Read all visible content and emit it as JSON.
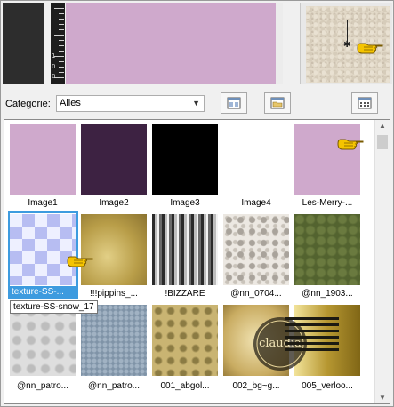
{
  "ruler": {
    "numbers": [
      "1",
      "0",
      "0"
    ]
  },
  "category": {
    "label": "Categorie:",
    "selected": "Alles"
  },
  "gallery": {
    "items": [
      {
        "label": "Image1"
      },
      {
        "label": "Image2"
      },
      {
        "label": "Image3"
      },
      {
        "label": "Image4"
      },
      {
        "label": "Les-Merry-..."
      },
      {
        "label": "texture-SS-..."
      },
      {
        "label": "!!!pippins_..."
      },
      {
        "label": "!BIZZARE"
      },
      {
        "label": "@nn_0704..."
      },
      {
        "label": "@nn_1903..."
      },
      {
        "label": "@nn_patro..."
      },
      {
        "label": "@nn_patro..."
      },
      {
        "label": "001_abgol..."
      },
      {
        "label": "002_bg~g..."
      },
      {
        "label": "005_verloo..."
      }
    ],
    "tooltip": "texture-SS-snow_17",
    "selected_index": 5
  },
  "watermark": {
    "text": "claudia"
  },
  "colors": {
    "pink": "#cfa9cc",
    "dark_purple": "#3d2242",
    "selection": "#3d9bdf",
    "pointer_hand": "#f5c400"
  }
}
